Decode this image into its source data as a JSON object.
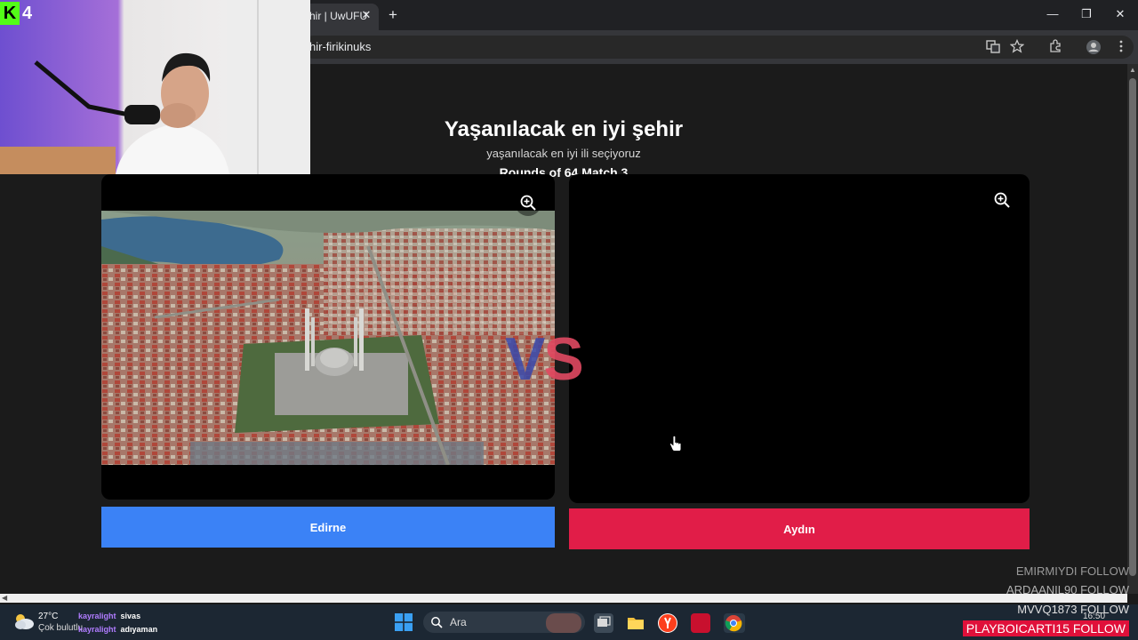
{
  "browser": {
    "tab_title": "hir | UwUFU",
    "tab_close": "✕",
    "new_tab": "+",
    "address": "hir-firikinuks",
    "window_controls": {
      "minimize": "—",
      "maximize": "❐",
      "close": "✕"
    },
    "toolbar_icons": [
      "translate-icon",
      "star-icon",
      "extensions-icon",
      "profile-icon",
      "menu-icon"
    ]
  },
  "page": {
    "title": "Yaşanılacak en iyi şehir",
    "subtitle": "yaşanılacak en iyi ili seçiyoruz",
    "rounds": "Rounds of 64 Match 3",
    "vs": {
      "v": "V",
      "s": "S"
    },
    "left_choice": {
      "label": "Edirne",
      "color": "#3b82f6"
    },
    "right_choice": {
      "label": "Aydın",
      "color": "#e11d48"
    }
  },
  "stream": {
    "cam_badge": "4",
    "follows": [
      "EMIRMIYDI  FOLLOW",
      "ARDAANIL90  FOLLOW",
      "MVVQ1873  FOLLOW",
      "PLAYBOICARTI15  FOLLOW"
    ]
  },
  "taskbar": {
    "weather_temp": "27°C",
    "weather_desc": "Çok bulutlu",
    "chat": [
      {
        "user": "kayralight",
        "msg": "sivas"
      },
      {
        "user": "kayralight",
        "msg": "adıyaman"
      }
    ],
    "search_label": "Ara",
    "clock": "16:50"
  }
}
